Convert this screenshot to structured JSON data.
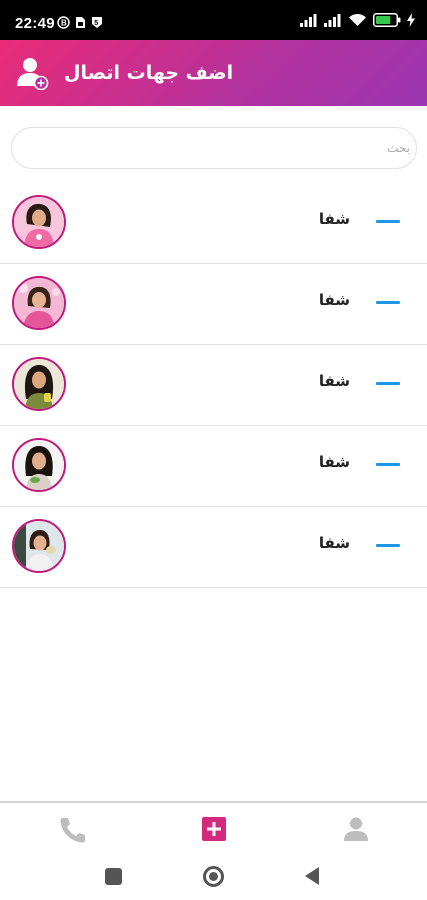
{
  "status_bar": {
    "time": "22:49",
    "battery_level": 0.75,
    "icons": [
      "circle-b-icon",
      "sim-card-icon",
      "shield-5-icon",
      "signal-icon",
      "signal-icon",
      "wifi-icon",
      "battery-icon",
      "charging-bolt-icon"
    ]
  },
  "header": {
    "title": "اضف جهات اتصال",
    "icon": "add-contact-icon",
    "gradient": [
      "#ea2b77",
      "#9c36b4"
    ]
  },
  "search": {
    "placeholder": "بحث",
    "value": ""
  },
  "contacts": [
    {
      "name": "شفا",
      "avatar": "avatar-photo"
    },
    {
      "name": "شفا",
      "avatar": "avatar-photo"
    },
    {
      "name": "شفا",
      "avatar": "avatar-photo"
    },
    {
      "name": "شفا",
      "avatar": "avatar-photo"
    },
    {
      "name": "شفا",
      "avatar": "avatar-photo"
    }
  ],
  "colors": {
    "accent": "#1f97e6",
    "avatar_ring": "#c2187b",
    "nav_active": "#d42a7e",
    "nav_inactive": "#bdbdbd"
  },
  "bottom_nav": [
    {
      "icon": "phone-icon",
      "active": false
    },
    {
      "icon": "add-square-icon",
      "active": true
    },
    {
      "icon": "person-icon",
      "active": false
    }
  ],
  "system_nav": [
    "recent-apps-icon",
    "home-icon",
    "back-icon"
  ]
}
